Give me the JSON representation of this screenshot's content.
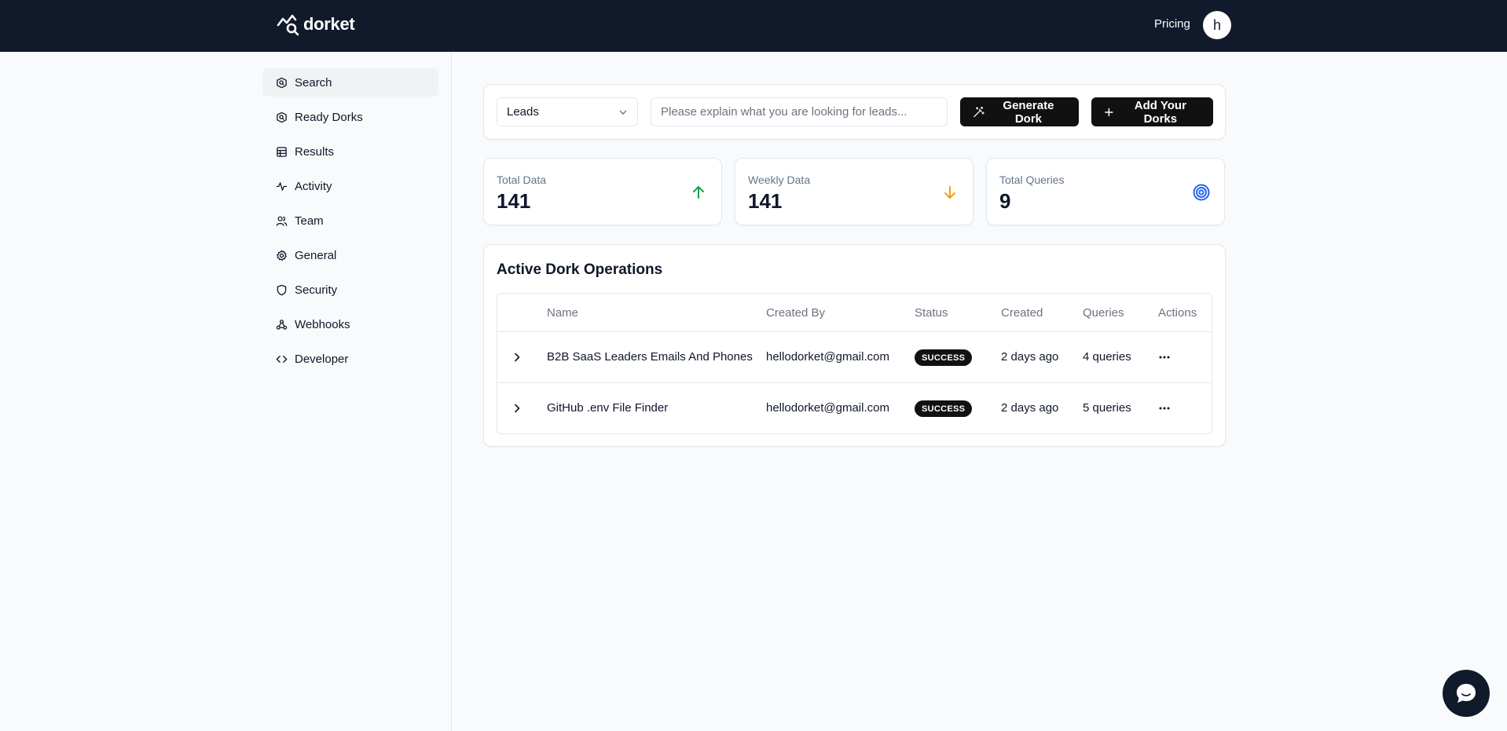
{
  "header": {
    "brand": "dorket",
    "pricing_label": "Pricing",
    "avatar_initial": "h"
  },
  "sidebar": {
    "items": [
      {
        "label": "Search",
        "icon": "search-doc-icon",
        "active": true
      },
      {
        "label": "Ready Dorks",
        "icon": "ready-dorks-icon"
      },
      {
        "label": "Results",
        "icon": "table-icon"
      },
      {
        "label": "Activity",
        "icon": "activity-icon"
      },
      {
        "label": "Team",
        "icon": "users-icon"
      },
      {
        "label": "General",
        "icon": "gear-icon"
      },
      {
        "label": "Security",
        "icon": "shield-icon"
      },
      {
        "label": "Webhooks",
        "icon": "webhook-icon"
      },
      {
        "label": "Developer",
        "icon": "code-icon"
      }
    ]
  },
  "search": {
    "category_value": "Leads",
    "placeholder": "Please explain what you are looking for leads...",
    "generate_label": "Generate Dork",
    "add_label": "Add Your Dorks"
  },
  "stats": [
    {
      "label": "Total Data",
      "value": "141",
      "icon": "arrow-up-icon",
      "color": "#16a34a"
    },
    {
      "label": "Weekly Data",
      "value": "141",
      "icon": "arrow-down-icon",
      "color": "#f59e0b"
    },
    {
      "label": "Total Queries",
      "value": "9",
      "icon": "target-icon",
      "color": "#2563eb"
    }
  ],
  "operations": {
    "title": "Active Dork Operations",
    "columns": [
      "Name",
      "Created By",
      "Status",
      "Created",
      "Queries",
      "Actions"
    ],
    "rows": [
      {
        "name": "B2B SaaS Leaders Emails And Phones",
        "created_by": "hellodorket@gmail.com",
        "status": "SUCCESS",
        "created": "2 days ago",
        "queries": "4 queries"
      },
      {
        "name": "GitHub .env File Finder",
        "created_by": "hellodorket@gmail.com",
        "status": "SUCCESS",
        "created": "2 days ago",
        "queries": "5 queries"
      }
    ]
  },
  "colors": {
    "topbar": "#111a2a",
    "accent_dark": "#111111",
    "success": "#16a34a",
    "warning": "#f59e0b",
    "info": "#2563eb"
  }
}
